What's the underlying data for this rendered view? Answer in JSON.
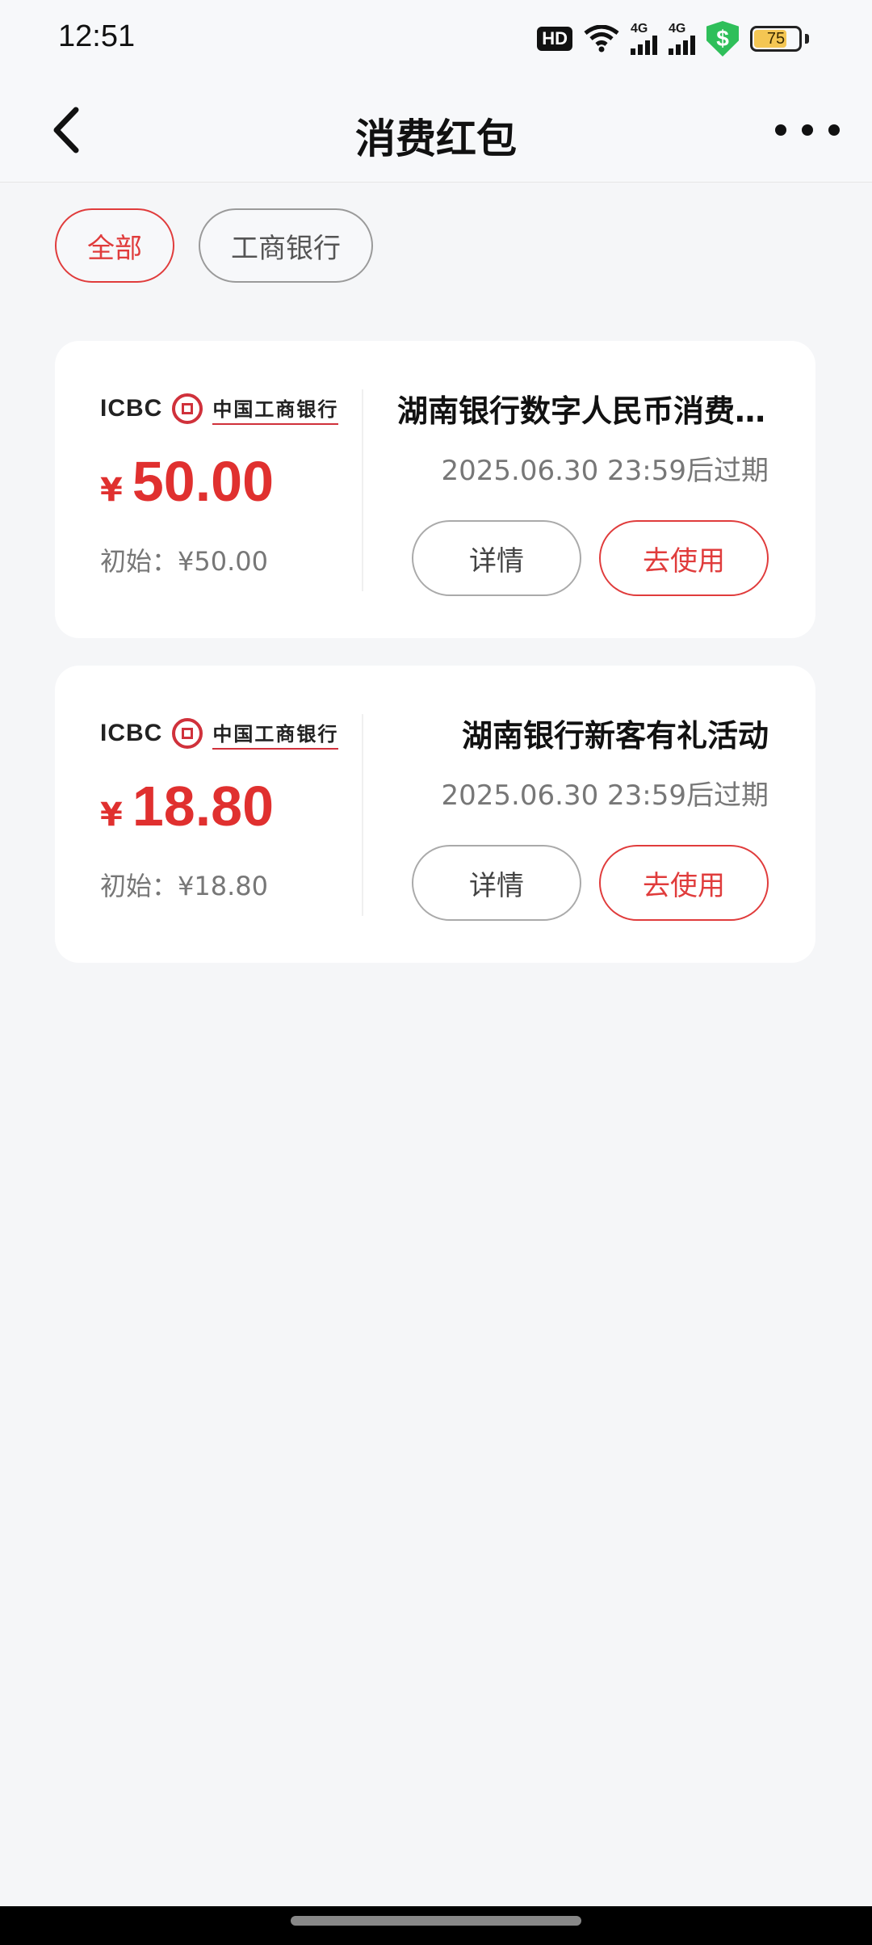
{
  "status_bar": {
    "time": "12:51",
    "hd": "HD",
    "network1": "4G",
    "network2": "4G",
    "shield_symbol": "$",
    "battery": "75",
    "battery_level": 0.75
  },
  "nav": {
    "title": "消费红包",
    "back_icon": "chevron-left-icon",
    "more_icon": "more-horizontal-icon"
  },
  "filters": [
    {
      "label": "全部",
      "active": true
    },
    {
      "label": "工商银行",
      "active": false
    }
  ],
  "coupons": [
    {
      "bank_logo_en": "ICBC",
      "bank_logo_cn": "中国工商银行",
      "currency": "¥",
      "amount": "50.00",
      "initial": "初始：¥50.00",
      "title": "湖南银行数字人民币消费红包",
      "expiry": "2025.06.30 23:59后过期",
      "detail_label": "详情",
      "use_label": "去使用"
    },
    {
      "bank_logo_en": "ICBC",
      "bank_logo_cn": "中国工商银行",
      "currency": "¥",
      "amount": "18.80",
      "initial": "初始：¥18.80",
      "title": "湖南银行新客有礼活动",
      "expiry": "2025.06.30 23:59后过期",
      "detail_label": "详情",
      "use_label": "去使用"
    }
  ],
  "colors": {
    "accent": "#e03c3c",
    "background": "#f5f6f8"
  }
}
